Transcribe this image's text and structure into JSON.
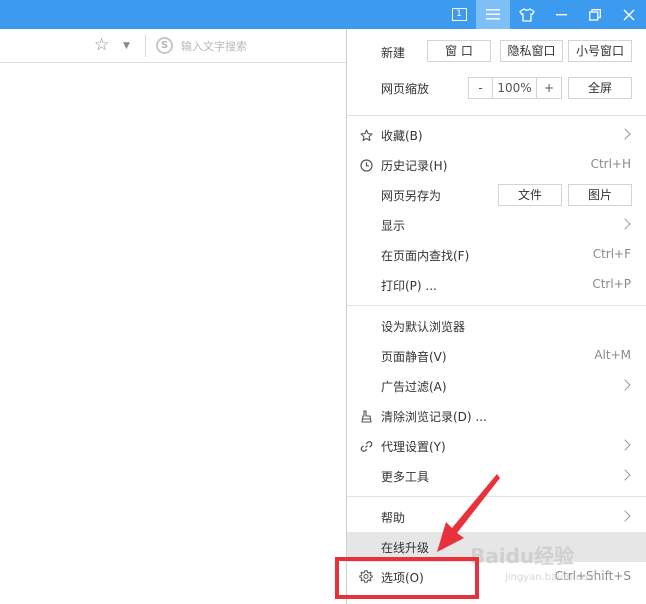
{
  "titlebar": {
    "tab_count": "1",
    "color": "#3d9bef",
    "active_color": "#7cc0f7"
  },
  "addressbar": {
    "search_placeholder": "输入文字搜索",
    "search_engine_glyph": "S"
  },
  "menu": {
    "new_label": "新建",
    "new_buttons": [
      "窗 口",
      "隐私窗口",
      "小号窗口"
    ],
    "zoom_label": "网页缩放",
    "zoom_minus": "-",
    "zoom_value": "100%",
    "zoom_plus": "+",
    "fullscreen": "全屏",
    "items": [
      {
        "label": "收藏(B)",
        "icon": "star-icon",
        "has_submenu": true
      },
      {
        "label": "历史记录(H)",
        "icon": "clock-icon",
        "shortcut": "Ctrl+H"
      },
      {
        "label": "网页另存为",
        "buttons": [
          "文件",
          "图片"
        ]
      },
      {
        "label": "显示",
        "has_submenu": true
      },
      {
        "label": "在页面内查找(F)",
        "shortcut": "Ctrl+F"
      },
      {
        "label": "打印(P) ...",
        "shortcut": "Ctrl+P"
      },
      {
        "label": "设为默认浏览器"
      },
      {
        "label": "页面静音(V)",
        "shortcut": "Alt+M"
      },
      {
        "label": "广告过滤(A)",
        "has_submenu": true
      },
      {
        "label": "清除浏览记录(D) ...",
        "icon": "broom-icon"
      },
      {
        "label": "代理设置(Y)",
        "icon": "link-icon",
        "has_submenu": true
      },
      {
        "label": "更多工具",
        "has_submenu": true
      },
      {
        "label": "帮助",
        "has_submenu": true
      },
      {
        "label": "在线升级",
        "highlighted": true
      },
      {
        "label": "选项(O)",
        "icon": "gear-icon",
        "shortcut": "Ctrl+Shift+S"
      }
    ]
  },
  "annotation": {
    "box_color": "#e8313b",
    "arrow_color": "#e8313b"
  },
  "watermark": {
    "text": "Baidu经验",
    "sub": "jingyan.baidu.com"
  }
}
